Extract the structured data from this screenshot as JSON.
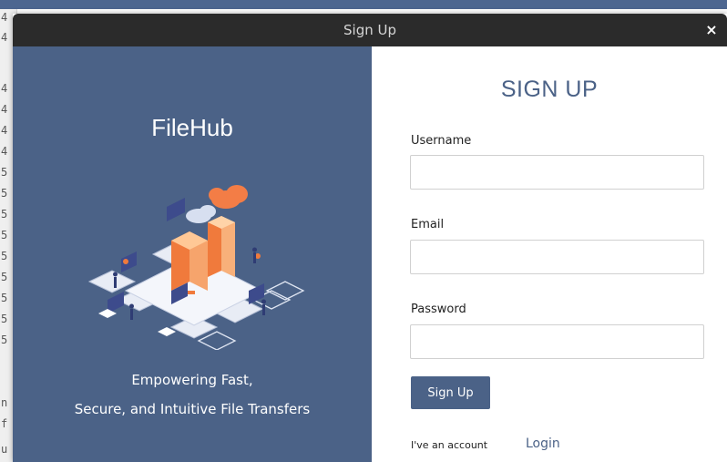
{
  "background_editor": {
    "line_numbers": [
      "4",
      "4",
      "",
      "4",
      "4",
      "4",
      "4",
      "5",
      "5",
      "5",
      "5",
      "5",
      "5",
      "5",
      "5",
      "5"
    ],
    "left_letters": [
      "n",
      "f",
      "u"
    ]
  },
  "dialog": {
    "title": "Sign Up",
    "close_glyph": "×"
  },
  "left_panel": {
    "brand": "FileHub",
    "tagline_line1": "Empowering Fast,",
    "tagline_line2": "Secure, and Intuitive File Transfers",
    "illustration_icon": "isometric-cloud-file-transfer-illustration"
  },
  "form": {
    "title": "SIGN UP",
    "username_label": "Username",
    "username_value": "",
    "email_label": "Email",
    "email_value": "",
    "password_label": "Password",
    "password_value": "",
    "submit_label": "Sign Up",
    "have_account_text": "I've an account",
    "login_link": "Login"
  },
  "colors": {
    "accent": "#4b6287",
    "titlebar": "#2b2b2b",
    "panel_text": "#ffffff"
  }
}
